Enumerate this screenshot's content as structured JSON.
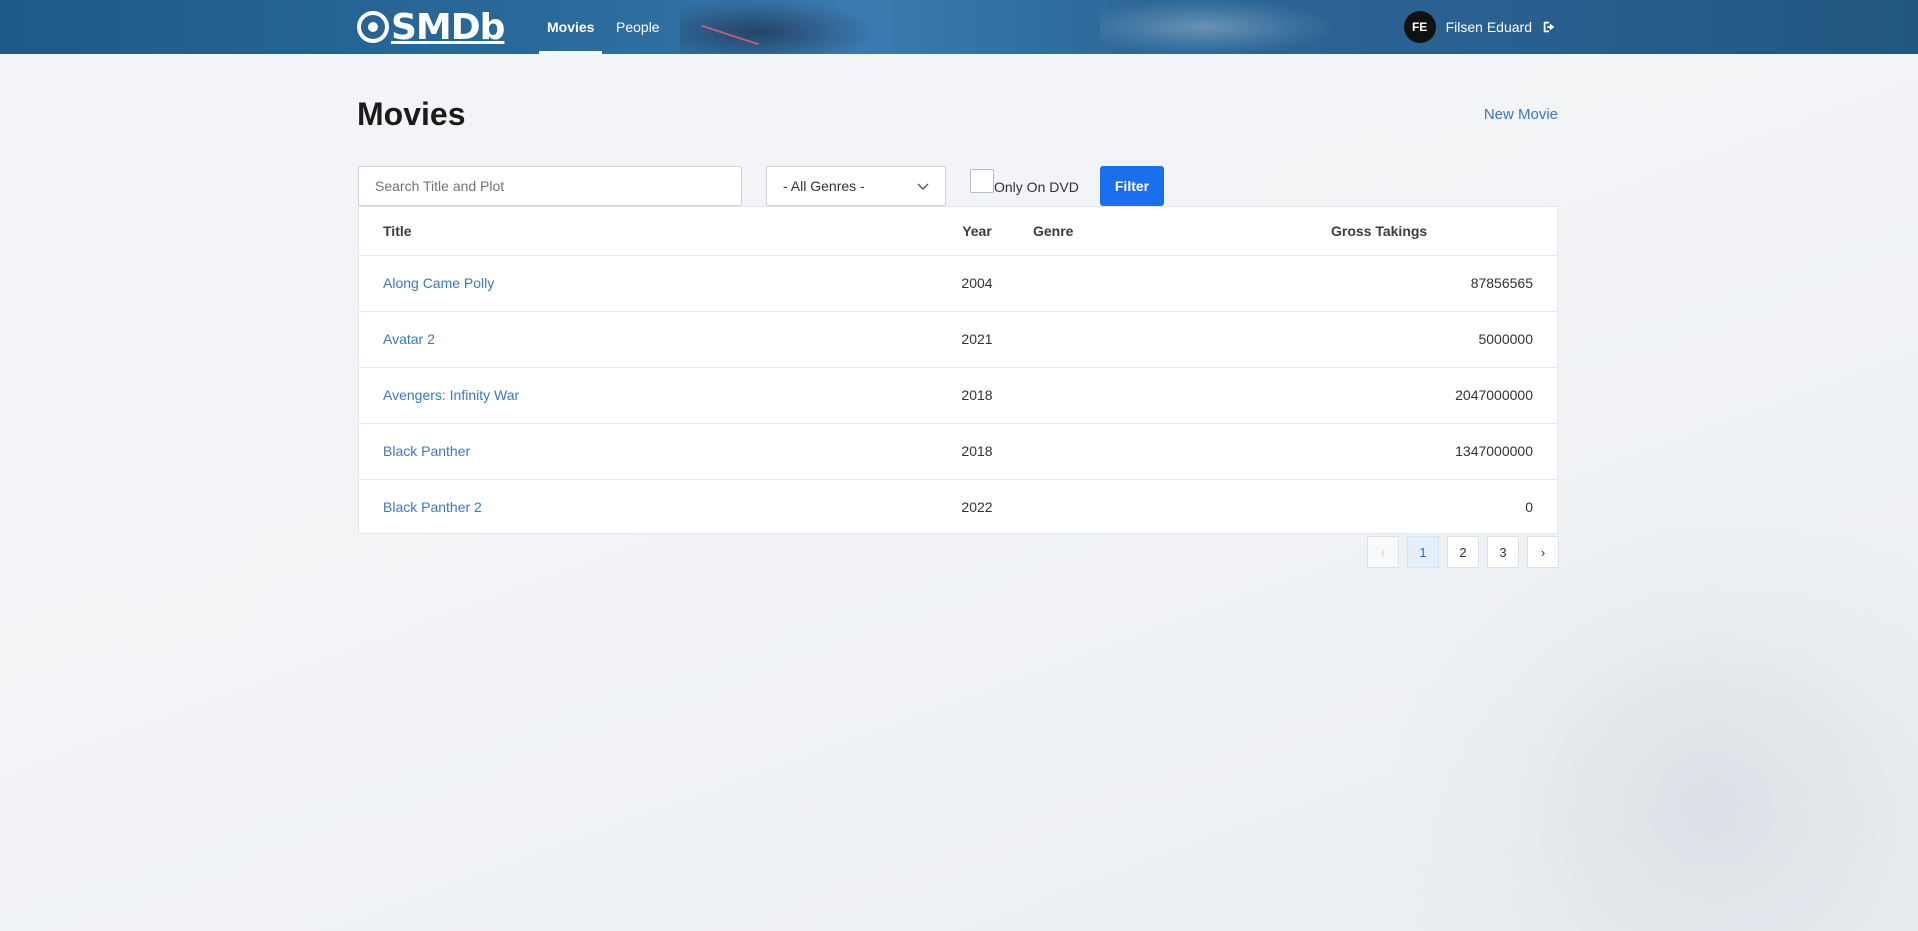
{
  "app": {
    "logo_text": "SMDb"
  },
  "nav": {
    "items": [
      {
        "label": "Movies",
        "active": true
      },
      {
        "label": "People",
        "active": false
      }
    ]
  },
  "user": {
    "initials": "FE",
    "name": "Filsen Eduard"
  },
  "page": {
    "title": "Movies",
    "new_movie_label": "New Movie"
  },
  "filters": {
    "search_placeholder": "Search Title and Plot",
    "search_value": "",
    "genre_selected": "- All Genres -",
    "dvd_label": "Only On DVD",
    "dvd_checked": false,
    "filter_button": "Filter"
  },
  "table": {
    "headers": {
      "title": "Title",
      "year": "Year",
      "genre": "Genre",
      "gross": "Gross Takings"
    },
    "rows": [
      {
        "title": "Along Came Polly",
        "year": "2004",
        "genre": "",
        "gross": "87856565"
      },
      {
        "title": "Avatar 2",
        "year": "2021",
        "genre": "",
        "gross": "5000000"
      },
      {
        "title": "Avengers: Infinity War",
        "year": "2018",
        "genre": "",
        "gross": "2047000000"
      },
      {
        "title": "Black Panther",
        "year": "2018",
        "genre": "",
        "gross": "1347000000"
      },
      {
        "title": "Black Panther 2",
        "year": "2022",
        "genre": "",
        "gross": "0"
      }
    ]
  },
  "pagination": {
    "prev": "‹",
    "pages": [
      "1",
      "2",
      "3"
    ],
    "current": "1",
    "next": "›"
  },
  "colors": {
    "accent": "#1a6ef0",
    "link": "#3a78c2",
    "nav_bg": "#285f8f"
  }
}
